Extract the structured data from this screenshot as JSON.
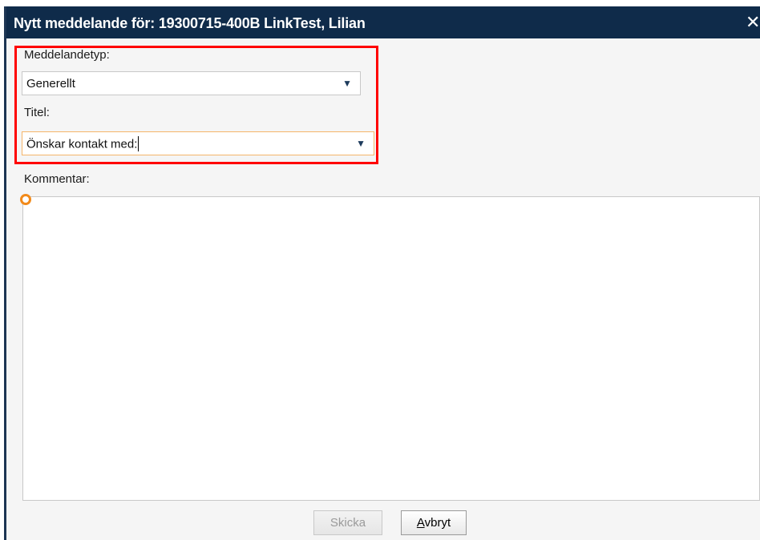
{
  "dialog": {
    "title": "Nytt meddelande för: 19300715-400B LinkTest, Lilian",
    "close_glyph": "✕"
  },
  "form": {
    "message_type_label": "Meddelandetyp:",
    "message_type_value": "Generellt",
    "title_label": "Titel:",
    "title_value": "Önskar kontakt med:",
    "comment_label": "Kommentar:",
    "comment_value": "",
    "dropdown_arrow": "▼"
  },
  "buttons": {
    "send_label": "Skicka",
    "cancel_mnemonic": "A",
    "cancel_rest": "vbryt"
  },
  "colors": {
    "titlebar": "#0f2b4a",
    "highlight_border": "#ff0000",
    "required_indicator": "#f28a1a",
    "focused_border": "#f5b56a"
  }
}
